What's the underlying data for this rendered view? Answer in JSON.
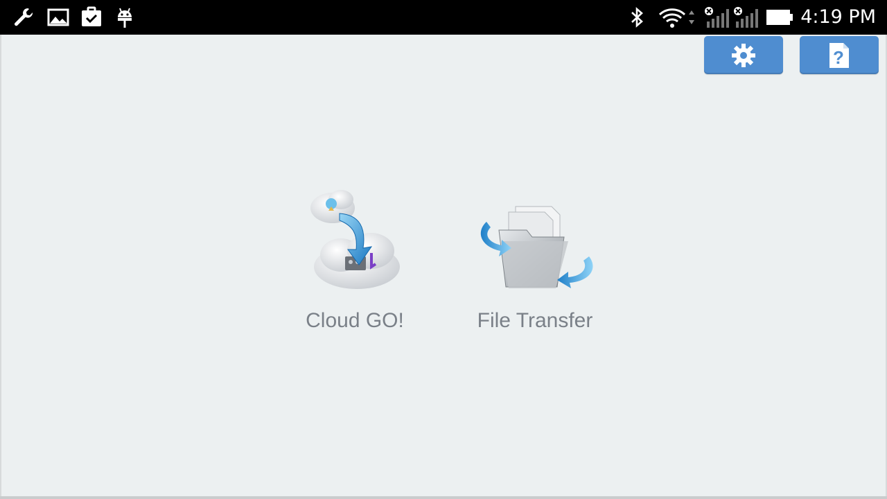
{
  "status_bar": {
    "time": "4:19 PM",
    "notification_icons": [
      "wrench-icon",
      "image-icon",
      "clipboard-check-icon",
      "android-icon"
    ],
    "system_icons": [
      "bluetooth-icon",
      "wifi-icon",
      "signal-no-sim-icon",
      "signal-no-sim-icon",
      "battery-icon"
    ]
  },
  "toolbar": {
    "settings_icon": "gear-icon",
    "help_icon": "help-document-icon",
    "button_color": "#4f8dd0"
  },
  "apps": [
    {
      "label": "Cloud GO!",
      "icon": "cloud-sync-icon"
    },
    {
      "label": "File Transfer",
      "icon": "folder-transfer-icon"
    }
  ],
  "colors": {
    "background": "#ecf0f1",
    "status_bar": "#000000",
    "label_text": "#7a8088"
  }
}
